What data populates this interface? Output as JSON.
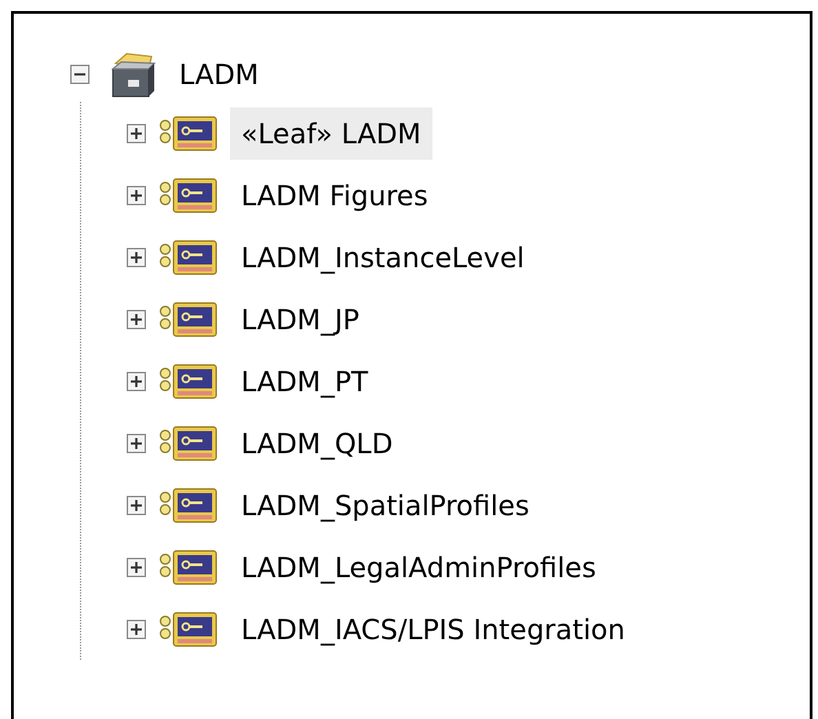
{
  "tree": {
    "label": "LADM",
    "expanded": true,
    "selected": false,
    "children": [
      {
        "label": "«Leaf» LADM",
        "expanded": false,
        "selected": true
      },
      {
        "label": "LADM Figures",
        "expanded": false,
        "selected": false
      },
      {
        "label": "LADM_InstanceLevel",
        "expanded": false,
        "selected": false
      },
      {
        "label": "LADM_JP",
        "expanded": false,
        "selected": false
      },
      {
        "label": "LADM_PT",
        "expanded": false,
        "selected": false
      },
      {
        "label": "LADM_QLD",
        "expanded": false,
        "selected": false
      },
      {
        "label": "LADM_SpatialProfiles",
        "expanded": false,
        "selected": false
      },
      {
        "label": "LADM_LegalAdminProfiles",
        "expanded": false,
        "selected": false
      },
      {
        "label": "LADM_IACS/LPIS Integration",
        "expanded": false,
        "selected": false
      }
    ]
  }
}
